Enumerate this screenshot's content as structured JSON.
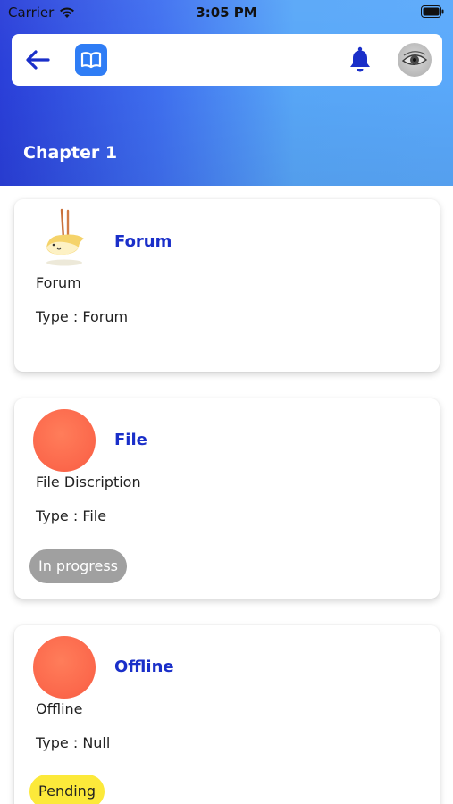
{
  "status_bar": {
    "carrier": "Carrier",
    "time": "3:05 PM"
  },
  "toolbar": {
    "back_icon": "arrow-left-icon",
    "book_icon": "book-icon",
    "bell_icon": "bell-icon",
    "avatar_icon": "eye-avatar"
  },
  "header": {
    "title": "Chapter 1",
    "gradient_start": "#2a3fd9",
    "gradient_end": "#5aa9fb"
  },
  "cards": [
    {
      "title": "Forum",
      "description": "Forum",
      "type": "Type : Forum",
      "icon": "forum-illustration",
      "status": ""
    },
    {
      "title": "File",
      "description": "File Discription",
      "type": "Type : File",
      "icon": "orange-circle",
      "status": "In progress"
    },
    {
      "title": "Offline",
      "description": "Offline",
      "type": "Type : Null",
      "icon": "orange-circle",
      "status": "Pending"
    }
  ],
  "colors": {
    "accent_title": "#1a2fc9",
    "icon_orange": "#fc6a4d",
    "badge_progress": "#a0a0a0",
    "badge_pending": "#fce93a",
    "toolbar_blue": "#2f7df5"
  }
}
